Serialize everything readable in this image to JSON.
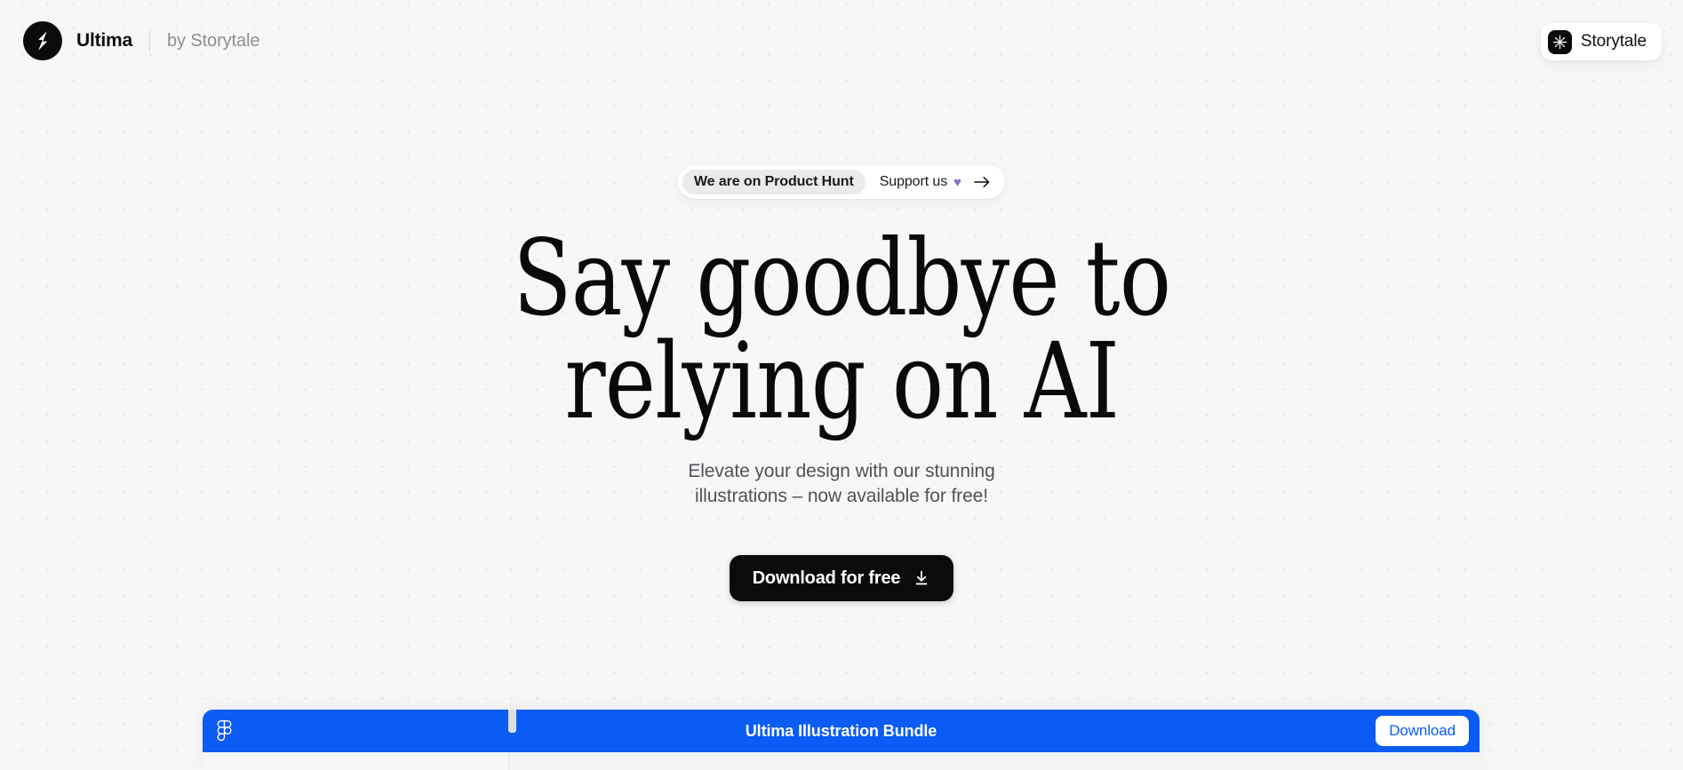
{
  "header": {
    "logo_icon": "lightning-bolt-logo",
    "brand_name": "Ultima",
    "by_line": "by Storytale",
    "badge": {
      "icon": "starburst-icon",
      "label": "Storytale"
    }
  },
  "hero": {
    "announcement": {
      "tag": "We are on Product Hunt",
      "text": "Support us",
      "heart": "♥",
      "arrow_icon": "arrow-right-icon"
    },
    "title": "Say goodbye to\nrelying on AI",
    "subtitle": "Elevate your design with our stunning\nillustrations – now available for free!",
    "cta": {
      "label": "Download for free",
      "icon": "download-icon"
    }
  },
  "preview": {
    "app_icon": "figma-logo",
    "title": "Ultima Illustration Bundle",
    "download_label": "Download"
  },
  "colors": {
    "background": "#f7f7f7",
    "dot_grid": "#e2e2e2",
    "ink": "#0b0b0b",
    "muted_text": "#8e8e8e",
    "subtitle_text": "#4f5257",
    "figma_blue": "#0a5cf5",
    "heart_purple": "#8b6fc4",
    "tag_background": "#ebebeb"
  }
}
